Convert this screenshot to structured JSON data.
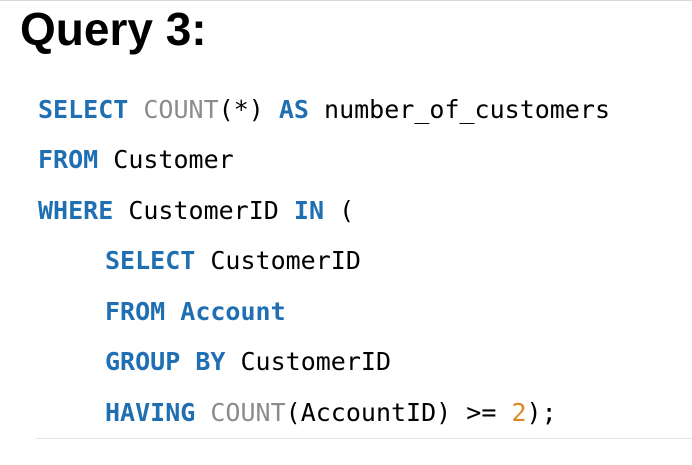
{
  "title": "Query 3:",
  "code": {
    "line1": {
      "kw_select": "SELECT",
      "fn_count": "COUNT",
      "args": "(*)",
      "kw_as": "AS",
      "alias": "number_of_customers"
    },
    "line2": {
      "kw_from": "FROM",
      "table": "Customer"
    },
    "line3": {
      "kw_where": "WHERE",
      "column": "CustomerID",
      "kw_in": "IN",
      "paren": "("
    },
    "line4": {
      "kw_select": "SELECT",
      "column": "CustomerID"
    },
    "line5": {
      "kw_from": "FROM",
      "table": "Account"
    },
    "line6": {
      "kw_group": "GROUP",
      "kw_by": "BY",
      "column": "CustomerID"
    },
    "line7": {
      "kw_having": "HAVING",
      "fn_count": "COUNT",
      "args": "(AccountID)",
      "operator": ">=",
      "number": "2",
      "tail": ");"
    }
  },
  "colors": {
    "keyword": "#1f6fb2",
    "function": "#8c8c8c",
    "number": "#e0862a",
    "identifier": "#000000"
  }
}
